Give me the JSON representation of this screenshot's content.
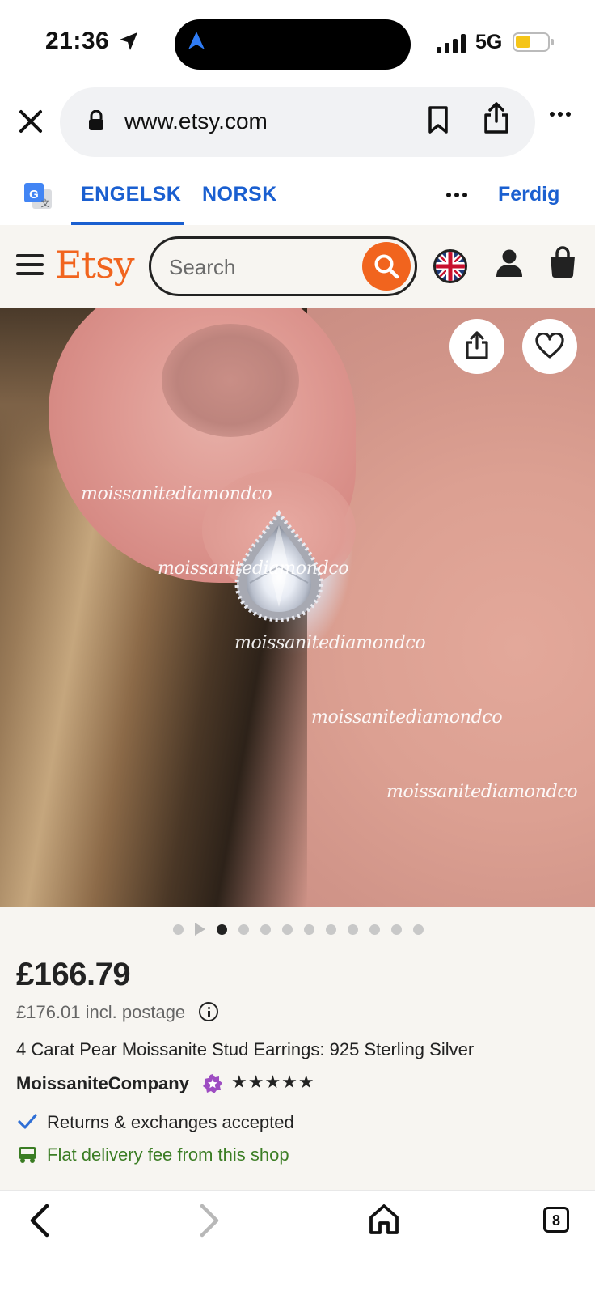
{
  "status_bar": {
    "time": "21:36",
    "network": "5G"
  },
  "browser": {
    "url": "www.etsy.com",
    "icons": [
      "close-icon",
      "lock-icon",
      "bookmark-icon",
      "share-icon",
      "more-icon"
    ]
  },
  "translate_bar": {
    "source_language": "ENGELSK",
    "target_language": "NORSK",
    "done_label": "Ferdig"
  },
  "etsy_header": {
    "logo": "Etsy",
    "search_placeholder": "Search",
    "accent_color": "#f1641e"
  },
  "product_image": {
    "watermark_text": "moissanitediamondco",
    "watermarks": [
      "moissanitediamondco",
      "moissanitediamondco",
      "moissanitediamondco",
      "moissanitediamondco",
      "moissanitediamondco"
    ],
    "image_count": 11,
    "active_index": 1
  },
  "listing": {
    "price": "£166.79",
    "postage_note": "£176.01 incl. postage",
    "title": "4 Carat Pear Moissanite Stud Earrings: 925 Sterling Silver",
    "shop_name": "MoissaniteCompany",
    "stars": "★★★★★",
    "rating_stars": 5,
    "returns_text": "Returns & exchanges accepted",
    "delivery_text": "Flat delivery fee from this shop",
    "delivery_color": "#3b7d24"
  },
  "bottom_bar": {
    "tab_count": "8"
  }
}
